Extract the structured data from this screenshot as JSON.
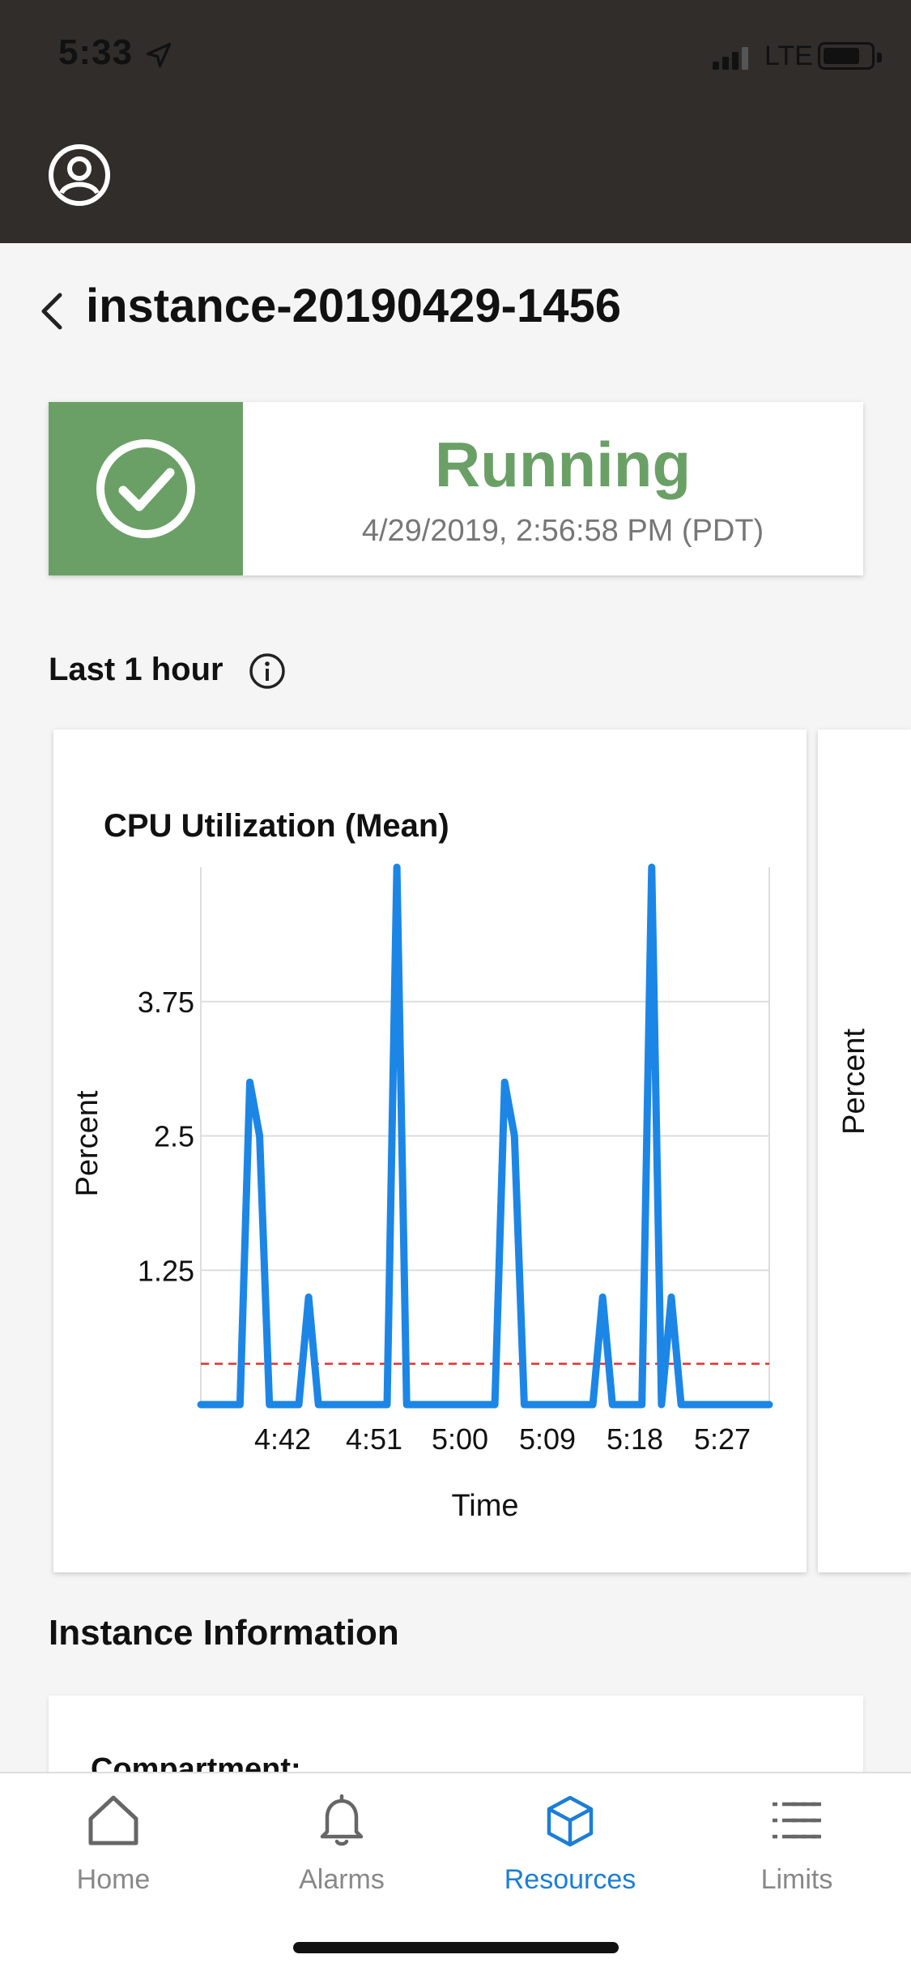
{
  "status_bar": {
    "time": "5:33",
    "network": "LTE"
  },
  "header": {
    "title": "instance-20190429-1456"
  },
  "status": {
    "state": "Running",
    "timestamp": "4/29/2019, 2:56:58 PM (PDT)",
    "color": "#6aa065"
  },
  "metrics": {
    "range_label": "Last 1 hour"
  },
  "chart_data": {
    "type": "line",
    "title": "CPU Utilization  (Mean)",
    "xlabel": "Time",
    "ylabel": "Percent",
    "yticks": [
      "1.25",
      "2.5",
      "3.75"
    ],
    "ylim": [
      0,
      5
    ],
    "xticks": [
      "4:42",
      "4:51",
      "5:00",
      "5:09",
      "5:18",
      "5:27"
    ],
    "series": [
      {
        "color": "#1c86e6",
        "points": [
          [
            0,
            0
          ],
          [
            4,
            0
          ],
          [
            5,
            3.0
          ],
          [
            6,
            2.5
          ],
          [
            7,
            0
          ],
          [
            10,
            0
          ],
          [
            11,
            1.0
          ],
          [
            12,
            0
          ],
          [
            19,
            0
          ],
          [
            20,
            5.0
          ],
          [
            21,
            0
          ],
          [
            30,
            0
          ],
          [
            31,
            3.0
          ],
          [
            32,
            2.5
          ],
          [
            33,
            0
          ],
          [
            40,
            0
          ],
          [
            41,
            1.0
          ],
          [
            42,
            0
          ],
          [
            45,
            0
          ],
          [
            46,
            5.0
          ],
          [
            47,
            0
          ],
          [
            48,
            1.0
          ],
          [
            49,
            0
          ],
          [
            58,
            0
          ]
        ]
      }
    ],
    "threshold": {
      "value": 0.38,
      "color": "#e03131",
      "style": "dashed"
    }
  },
  "second_chart": {
    "ylabel": "Percent"
  },
  "instance_info": {
    "title": "Instance Information",
    "first_field": "Compartment:"
  },
  "tabs": [
    {
      "label": "Home",
      "icon": "home-icon",
      "active": false
    },
    {
      "label": "Alarms",
      "icon": "bell-icon",
      "active": false
    },
    {
      "label": "Resources",
      "icon": "cube-icon",
      "active": true
    },
    {
      "label": "Limits",
      "icon": "list-icon",
      "active": false
    }
  ]
}
